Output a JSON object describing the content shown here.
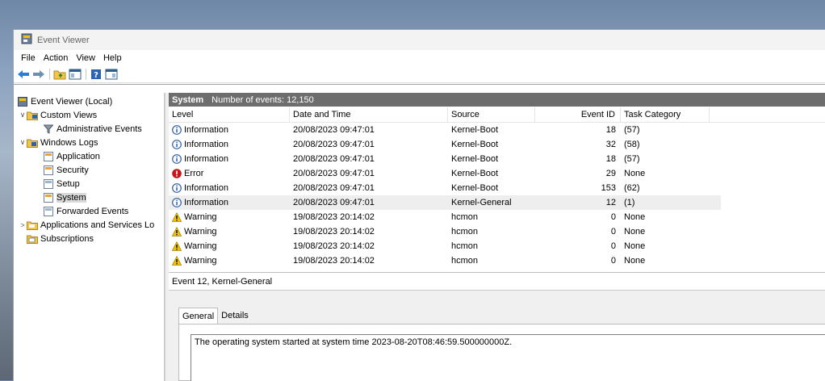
{
  "window": {
    "title": "Event Viewer"
  },
  "menu": [
    "File",
    "Action",
    "View",
    "Help"
  ],
  "tree": {
    "items": [
      {
        "label": "Event Viewer (Local)"
      },
      {
        "label": "Custom Views"
      },
      {
        "label": "Administrative Events"
      },
      {
        "label": "Windows Logs"
      },
      {
        "label": "Application"
      },
      {
        "label": "Security"
      },
      {
        "label": "Setup"
      },
      {
        "label": "System"
      },
      {
        "label": "Forwarded Events"
      },
      {
        "label": "Applications and Services Lo"
      },
      {
        "label": "Subscriptions"
      }
    ]
  },
  "main": {
    "log_name": "System",
    "count_label": "Number of events: 12,150",
    "columns": [
      "Level",
      "Date and Time",
      "Source",
      "Event ID",
      "Task Category"
    ],
    "rows": [
      {
        "level": "Information",
        "date": "20/08/2023 09:47:01",
        "source": "Kernel-Boot",
        "id": "18",
        "task": "(57)"
      },
      {
        "level": "Information",
        "date": "20/08/2023 09:47:01",
        "source": "Kernel-Boot",
        "id": "32",
        "task": "(58)"
      },
      {
        "level": "Information",
        "date": "20/08/2023 09:47:01",
        "source": "Kernel-Boot",
        "id": "18",
        "task": "(57)"
      },
      {
        "level": "Error",
        "date": "20/08/2023 09:47:01",
        "source": "Kernel-Boot",
        "id": "29",
        "task": "None"
      },
      {
        "level": "Information",
        "date": "20/08/2023 09:47:01",
        "source": "Kernel-Boot",
        "id": "153",
        "task": "(62)"
      },
      {
        "level": "Information",
        "date": "20/08/2023 09:47:01",
        "source": "Kernel-General",
        "id": "12",
        "task": "(1)"
      },
      {
        "level": "Warning",
        "date": "19/08/2023 20:14:02",
        "source": "hcmon",
        "id": "0",
        "task": "None"
      },
      {
        "level": "Warning",
        "date": "19/08/2023 20:14:02",
        "source": "hcmon",
        "id": "0",
        "task": "None"
      },
      {
        "level": "Warning",
        "date": "19/08/2023 20:14:02",
        "source": "hcmon",
        "id": "0",
        "task": "None"
      },
      {
        "level": "Warning",
        "date": "19/08/2023 20:14:02",
        "source": "hcmon",
        "id": "0",
        "task": "None"
      }
    ],
    "selected_row": 5
  },
  "detail": {
    "title": "Event 12, Kernel-General",
    "tabs": [
      "General",
      "Details"
    ],
    "message": "The operating system started at system time 2023-08-20T08:46:59.500000000Z."
  },
  "colors": {
    "info": "#2b5ea7",
    "error": "#c4161c",
    "warning": "#f2c300",
    "header_bar": "#6d6d6d"
  }
}
